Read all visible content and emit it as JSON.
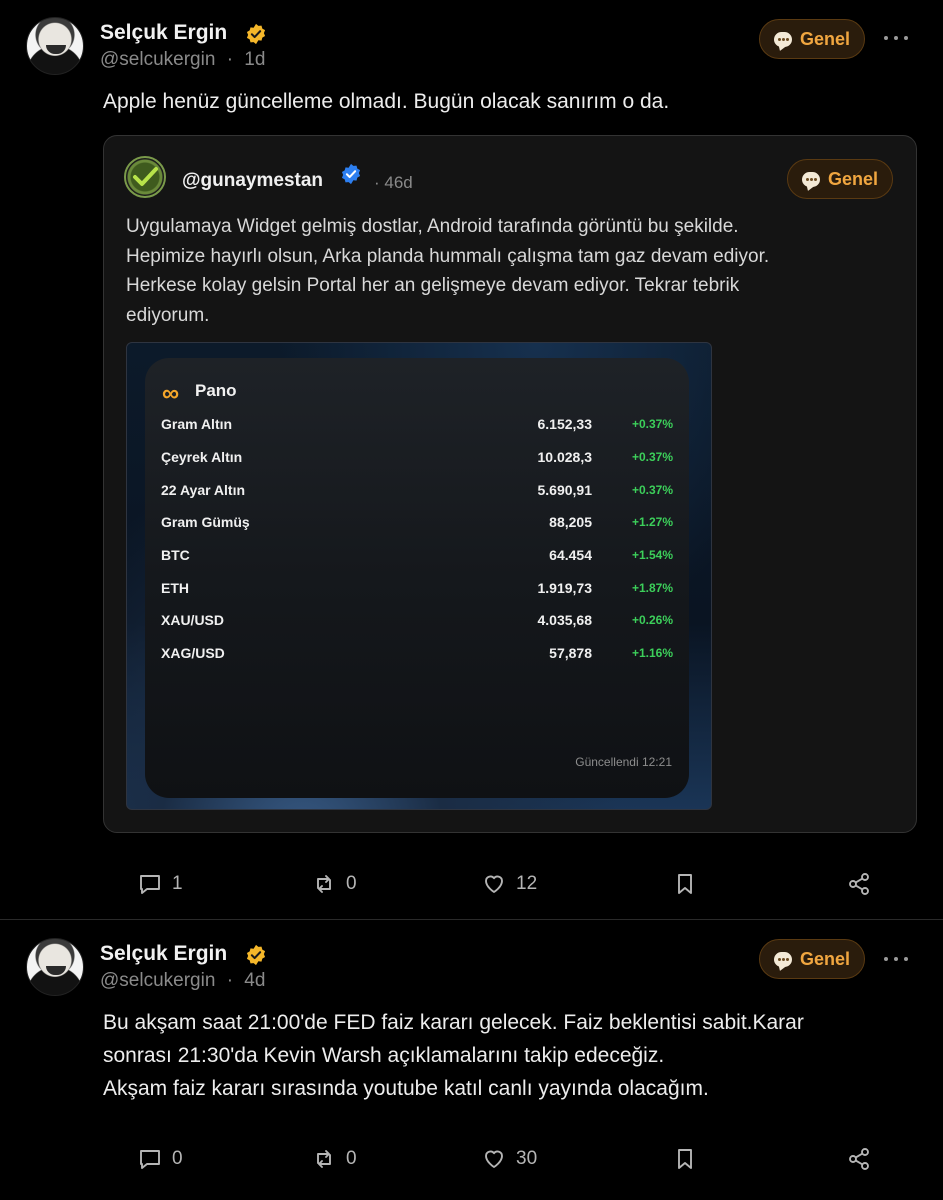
{
  "post1": {
    "author": "Selçuk Ergin",
    "handle": "@selcukergin",
    "separator": "·",
    "age": "1d",
    "tag": "Genel",
    "text": "Apple henüz güncelleme olmadı. Bugün olacak sanırım o da.",
    "quote": {
      "handle": "@gunaymestan",
      "age": "· 46d",
      "tag": "Genel",
      "lines": [
        "Uygulamaya Widget gelmiş dostlar, Android tarafında görüntü bu şekilde.",
        "Hepimize hayırlı olsun, Arka planda hummalı çalışma tam gaz devam ediyor.",
        "Herkese kolay gelsin Portal her an gelişmeye devam ediyor. Tekrar tebrik",
        "ediyorum."
      ],
      "widget": {
        "logo": "∞",
        "title": "Pano",
        "rows": [
          {
            "label": "Gram Altın",
            "value": "6.152,33",
            "change": "+0.37%"
          },
          {
            "label": "Çeyrek Altın",
            "value": "10.028,3",
            "change": "+0.37%"
          },
          {
            "label": "22 Ayar Altın",
            "value": "5.690,91",
            "change": "+0.37%"
          },
          {
            "label": "Gram Gümüş",
            "value": "88,205",
            "change": "+1.27%"
          },
          {
            "label": "BTC",
            "value": "64.454",
            "change": "+1.54%"
          },
          {
            "label": "ETH",
            "value": "1.919,73",
            "change": "+1.87%"
          },
          {
            "label": "XAU/USD",
            "value": "4.035,68",
            "change": "+0.26%"
          },
          {
            "label": "XAG/USD",
            "value": "57,878",
            "change": "+1.16%"
          }
        ],
        "updated": "Güncellendi 12:21"
      }
    },
    "actions": {
      "comments": "1",
      "reposts": "0",
      "likes": "12"
    }
  },
  "post2": {
    "author": "Selçuk Ergin",
    "handle": "@selcukergin",
    "separator": "·",
    "age": "4d",
    "tag": "Genel",
    "lines": [
      "Bu akşam saat 21:00'de FED faiz kararı gelecek. Faiz beklentisi sabit.Karar",
      "sonrası 21:30'da Kevin Warsh açıklamalarını takip edeceğiz.",
      "Akşam faiz kararı sırasında youtube katıl canlı yayında olacağım."
    ],
    "actions": {
      "comments": "0",
      "reposts": "0",
      "likes": "30"
    }
  },
  "colors": {
    "background": "#000000",
    "accent_orange": "#f0a640",
    "verified_gold": "#f5b72a",
    "verified_blue": "#2d7ff0",
    "positive_green": "#3ccf5a"
  },
  "icons": [
    "verified-badge-icon",
    "chat-bubble-icon",
    "more-dots-icon",
    "comment-icon",
    "repost-icon",
    "heart-icon",
    "bookmark-icon",
    "share-icon"
  ]
}
